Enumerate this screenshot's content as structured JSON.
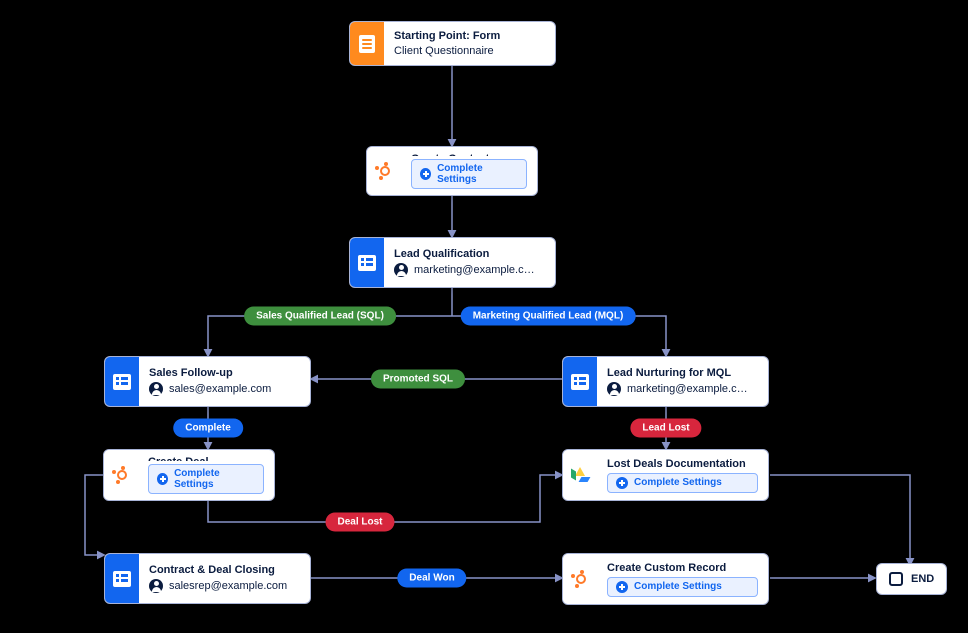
{
  "nodes": {
    "start": {
      "title": "Starting Point: Form",
      "subtitle": "Client Questionnaire"
    },
    "createContact": {
      "title": "Create Contact",
      "cta": "Complete Settings"
    },
    "leadQualification": {
      "title": "Lead Qualification",
      "assignee": "marketing@example.c…"
    },
    "salesFollowUp": {
      "title": "Sales Follow-up",
      "assignee": "sales@example.com"
    },
    "leadNurturing": {
      "title": "Lead Nurturing for MQL",
      "assignee": "marketing@example.c…"
    },
    "createDeal": {
      "title": "Create Deal",
      "cta": "Complete Settings"
    },
    "lostDealsDoc": {
      "title": "Lost Deals Documentation",
      "cta": "Complete Settings"
    },
    "contractClosing": {
      "title": "Contract & Deal Closing",
      "assignee": "salesrep@example.com"
    },
    "createCustomRecord": {
      "title": "Create Custom Record",
      "cta": "Complete Settings"
    },
    "end": {
      "label": "END"
    }
  },
  "edges": {
    "sql": "Sales Qualified Lead (SQL)",
    "mql": "Marketing Qualified Lead (MQL)",
    "promotedSql": "Promoted SQL",
    "complete": "Complete",
    "leadLost": "Lead Lost",
    "dealLost": "Deal Lost",
    "dealWon": "Deal Won"
  },
  "colors": {
    "accent_blue": "#1266ef",
    "accent_orange": "#ff8a1e",
    "badge_green": "#3e8f3e",
    "badge_red": "#d7263d",
    "connector": "#8893c7"
  }
}
